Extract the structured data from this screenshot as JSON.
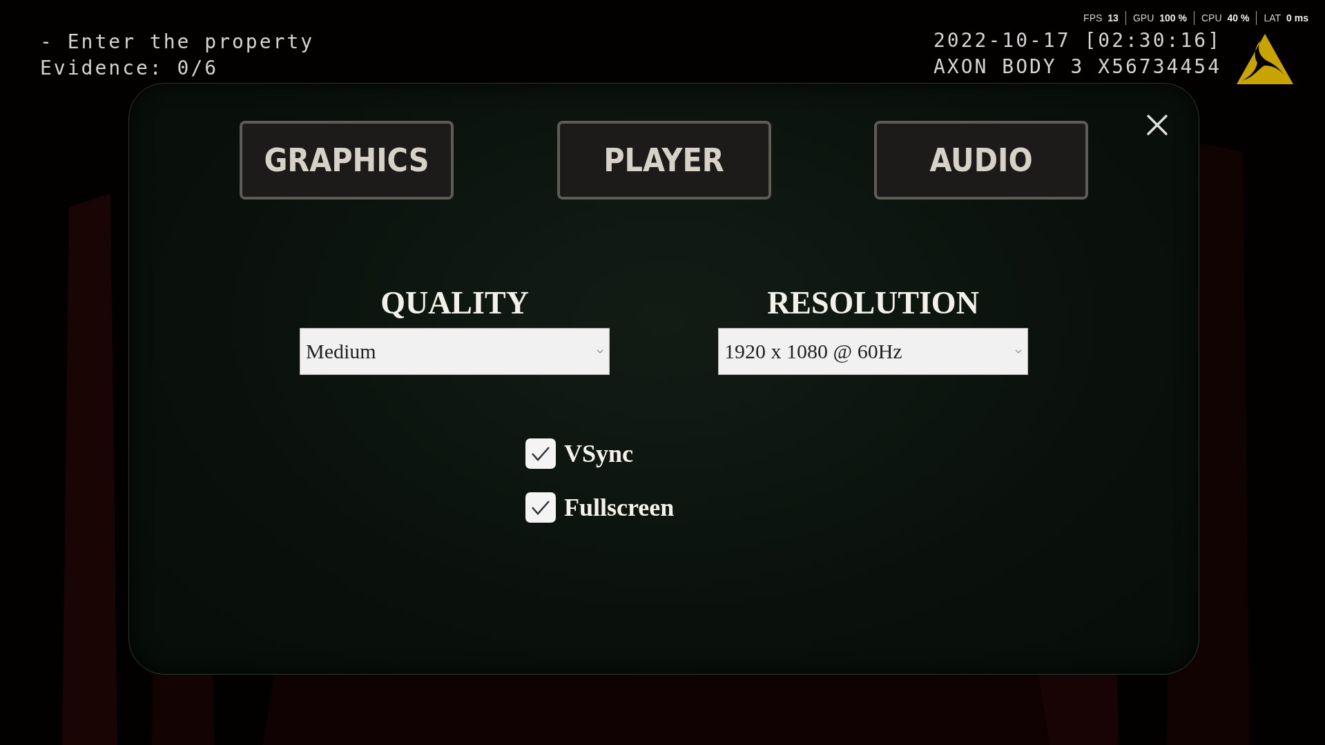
{
  "objective": {
    "task": "- Enter the property",
    "evidence": "Evidence: 0/6"
  },
  "stats": [
    {
      "label": "FPS",
      "value": "13"
    },
    {
      "label": "GPU",
      "value": "100 %"
    },
    {
      "label": "CPU",
      "value": "40 %"
    },
    {
      "label": "LAT",
      "value": "0 ms"
    }
  ],
  "camera": {
    "timestamp": "2022-10-17 [02:30:16]",
    "device": "AXON BODY 3 X56734454"
  },
  "settings": {
    "tabs": [
      {
        "label": "GRAPHICS",
        "selected": false
      },
      {
        "label": "PLAYER",
        "selected": false
      },
      {
        "label": "AUDIO",
        "selected": false
      }
    ],
    "sections": [
      {
        "kind": "dropdown",
        "title": "QUALITY",
        "value": "Medium"
      },
      {
        "kind": "dropdown",
        "title": "RESOLUTION",
        "value": "1920 x 1080 @ 60Hz"
      }
    ],
    "options": [
      {
        "kind": "checkbox",
        "label": "VSync",
        "checked": true
      },
      {
        "kind": "checkbox",
        "label": "Fullscreen",
        "checked": true
      }
    ]
  }
}
